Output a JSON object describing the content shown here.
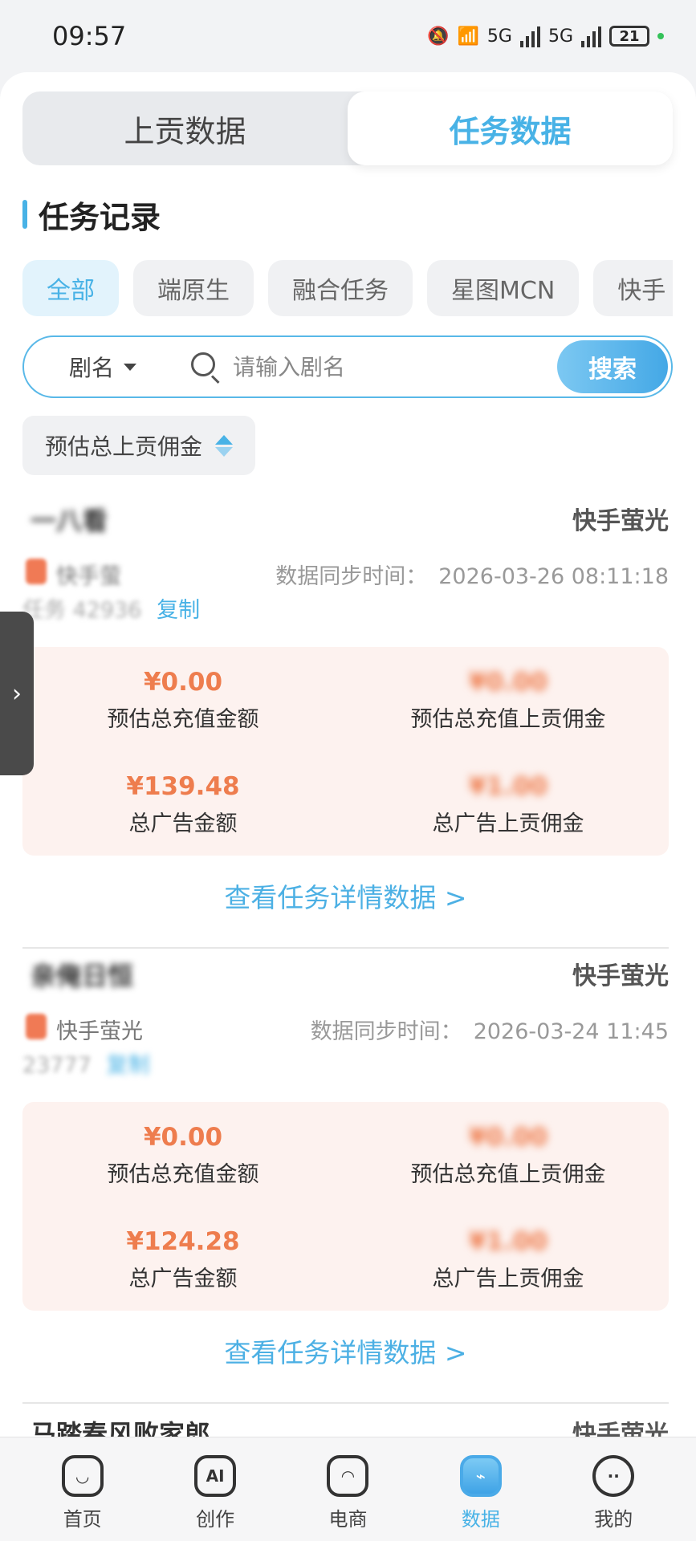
{
  "status_bar": {
    "time": "09:57",
    "signal1": "5G",
    "signal2": "5G",
    "battery": "21"
  },
  "segment": {
    "tabs": [
      {
        "label": "上贡数据"
      },
      {
        "label": "任务数据"
      }
    ],
    "active": 1
  },
  "section": {
    "title": "任务记录"
  },
  "filters": {
    "chips": [
      "全部",
      "端原生",
      "融合任务",
      "星图MCN",
      "快手"
    ],
    "active": 0
  },
  "search": {
    "type_label": "剧名",
    "placeholder": "请输入剧名",
    "button": "搜索"
  },
  "sort": {
    "label": "预估总上贡佣金"
  },
  "tasks": [
    {
      "name": "一八看",
      "platform": "快手萤光",
      "account": "快手萤",
      "sync_label": "数据同步时间：",
      "sync_time": "2026-03-26 08:11:18",
      "task_id": "任务 42936",
      "copy_label": "复制",
      "stats": [
        {
          "value": "¥0.00",
          "label": "预估总充值金额"
        },
        {
          "value": "¥0.00",
          "label": "预估总充值上贡佣金"
        },
        {
          "value": "¥139.48",
          "label": "总广告金额"
        },
        {
          "value": "¥1.00",
          "label": "总广告上贡佣金"
        }
      ],
      "link": "查看任务详情数据 >"
    },
    {
      "name": "亲俺日恒",
      "platform": "快手萤光",
      "account": "快手萤光",
      "sync_label": "数据同步时间：",
      "sync_time": "2026-03-24 11:45",
      "task_id": "23777",
      "copy_label": "复制",
      "stats": [
        {
          "value": "¥0.00",
          "label": "预估总充值金额"
        },
        {
          "value": "¥0.00",
          "label": "预估总充值上贡佣金"
        },
        {
          "value": "¥124.28",
          "label": "总广告金额"
        },
        {
          "value": "¥1.00",
          "label": "总广告上贡佣金"
        }
      ],
      "link": "查看任务详情数据 >"
    }
  ],
  "partial_task": {
    "name": "马踏春风败家郎",
    "platform": "快手萤光"
  },
  "bottom_nav": [
    {
      "label": "首页",
      "icon": "home-icon"
    },
    {
      "label": "创作",
      "icon": "ai-create-icon"
    },
    {
      "label": "电商",
      "icon": "shopping-bag-icon"
    },
    {
      "label": "数据",
      "icon": "data-chart-icon"
    },
    {
      "label": "我的",
      "icon": "profile-icon"
    }
  ],
  "nav_active": 3,
  "colors": {
    "accent": "#48b2e6",
    "amount": "#ee7d4e",
    "stats_bg": "#fdf2ef"
  }
}
